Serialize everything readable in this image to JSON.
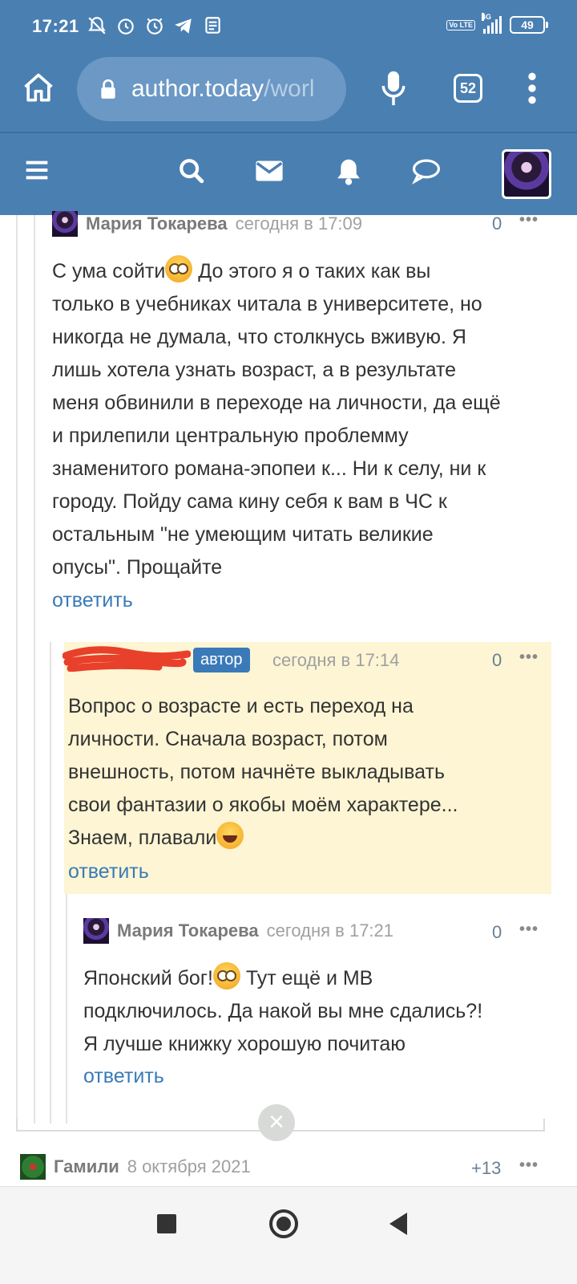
{
  "status_bar": {
    "time": "17:21",
    "battery": "49",
    "network": "4G",
    "volte": "Vo LTE"
  },
  "browser": {
    "url_host": "author.today",
    "url_path": "/worl",
    "tab_count": "52"
  },
  "comments": [
    {
      "author": "Мария Токарева",
      "time": "сегодня в 17:09",
      "score": "0",
      "lines": [
        "С ума сойти",
        "До этого я о таких как вы",
        "только в учебниках читала в университете, но",
        "никогда не думала, что столкнусь вживую. Я",
        "лишь хотела узнать возраст, а в результате",
        "меня обвинили в переходе на личности, да ещё",
        "и прилепили центральную проблемму",
        "знаменитого романа-эпопеи к... Ни к селу, ни к",
        "городу. Пойду сама кину себя к вам в ЧС к",
        "остальным \"не умеющим читать великие",
        "опусы\". Прощайте"
      ],
      "reply": "ответить"
    },
    {
      "badge": "автор",
      "time": "сегодня в 17:14",
      "score": "0",
      "lines": [
        "Вопрос о возрасте и есть переход на",
        "личности. Сначала возраст, потом",
        "внешность, потом начнёте выкладывать",
        "свои фантазии о якобы моём характере...",
        "Знаем, плавали"
      ],
      "reply": "ответить"
    },
    {
      "author": "Мария Токарева",
      "time": "сегодня в 17:21",
      "score": "0",
      "lines": [
        "Японский  бог!",
        "Тут ещё и МВ",
        "подключилось. Да накой вы мне сдались?!",
        "Я лучше книжку хорошую почитаю"
      ],
      "reply": "ответить"
    },
    {
      "author": "Гамили",
      "time": "8 октября 2021",
      "score": "+13"
    }
  ],
  "more_label": "•••",
  "close_label": "×"
}
